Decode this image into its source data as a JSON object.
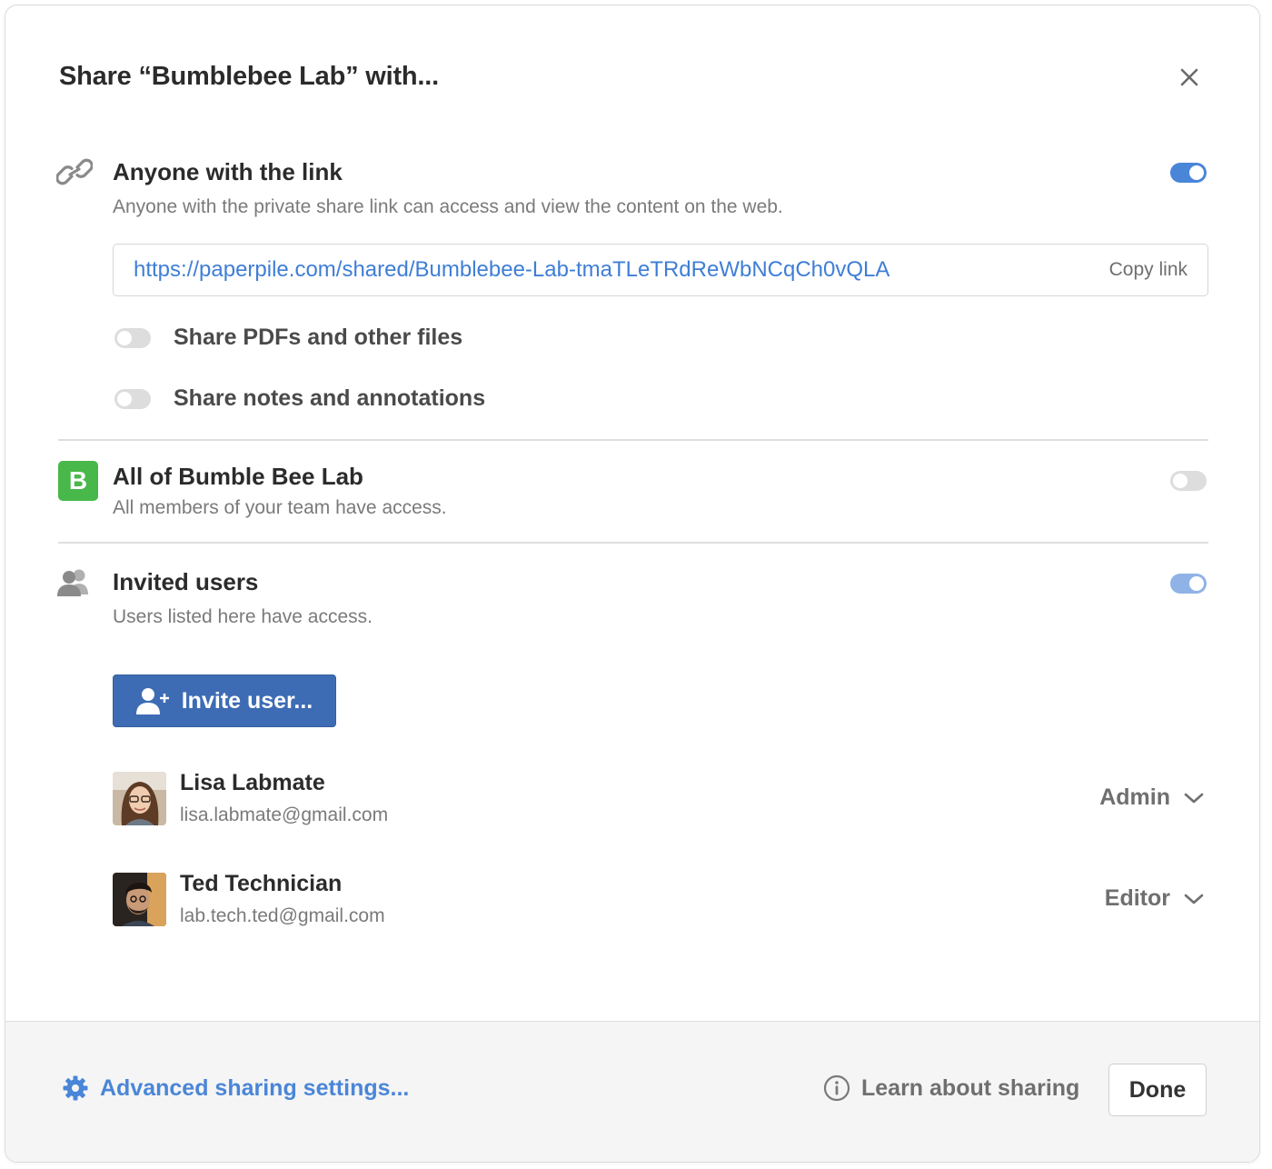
{
  "dialog": {
    "title": "Share “Bumblebee Lab” with..."
  },
  "link_section": {
    "title": "Anyone with the link",
    "subtitle": "Anyone with the private share link can access and view the content on the web.",
    "enabled": true,
    "url": "https://paperpile.com/shared/Bumblebee-Lab-tmaTLeTRdReWbNCqCh0vQLA",
    "copy_label": "Copy link",
    "options": [
      {
        "label": "Share PDFs and other files",
        "enabled": false
      },
      {
        "label": "Share notes and annotations",
        "enabled": false
      }
    ]
  },
  "team_section": {
    "badge": "B",
    "title": "All of Bumble Bee Lab",
    "subtitle": "All members of your team have access.",
    "enabled": false
  },
  "invited_section": {
    "title": "Invited users",
    "subtitle": "Users listed here have access.",
    "enabled": true,
    "invite_label": "Invite user...",
    "users": [
      {
        "name": "Lisa Labmate",
        "email": "lisa.labmate@gmail.com",
        "role": "Admin"
      },
      {
        "name": "Ted Technician",
        "email": "lab.tech.ted@gmail.com",
        "role": "Editor"
      }
    ]
  },
  "footer": {
    "advanced_label": "Advanced sharing settings...",
    "learn_label": "Learn about sharing",
    "done_label": "Done"
  },
  "colors": {
    "accent": "#4a86d8",
    "primary_button": "#3d6cb4",
    "team_badge": "#48b84a",
    "link_text": "#3f7ed6"
  },
  "icons": [
    "close-icon",
    "link-icon",
    "users-icon",
    "add-user-icon",
    "chevron-down-icon",
    "gear-icon",
    "info-icon"
  ]
}
